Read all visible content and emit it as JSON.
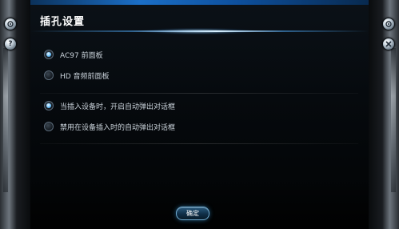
{
  "window": {
    "title": "插孔设置"
  },
  "options": [
    {
      "label": "AC97 前面板",
      "checked": true
    },
    {
      "label": "HD 音频前面板",
      "checked": false
    },
    {
      "label": "当插入设备时，开启自动弹出对话框",
      "checked": true
    },
    {
      "label": "禁用在设备插入时的自动弹出对话框",
      "checked": false
    }
  ],
  "footer": {
    "confirm_label": "确定"
  },
  "side_buttons": {
    "left": [
      "gear-icon",
      "help-icon"
    ],
    "right": [
      "gear-icon",
      "close-icon"
    ],
    "help_glyph": "?"
  },
  "colors": {
    "accent": "#1b6fc7",
    "radio_selected": "#6dc3ff",
    "text": "#c9d2da"
  }
}
